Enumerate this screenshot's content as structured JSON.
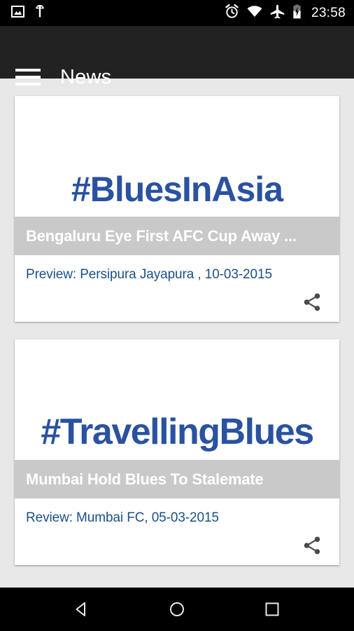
{
  "status_bar": {
    "time": "23:58",
    "left_icons": [
      {
        "name": "screenshot-icon",
        "label": "screenshot"
      },
      {
        "name": "android-debug-icon",
        "label": "android-debug"
      }
    ],
    "right_icons": [
      {
        "name": "alarm-icon",
        "label": "alarm"
      },
      {
        "name": "wifi-icon",
        "label": "wifi"
      },
      {
        "name": "airplane-mode-icon",
        "label": "airplane-mode"
      },
      {
        "name": "battery-charging-icon",
        "label": "battery-charging"
      }
    ],
    "background_color": "#000000"
  },
  "app_bar": {
    "title": "News",
    "menu_icon": "hamburger-icon",
    "background_color": "#222222",
    "title_color": "#ffffff"
  },
  "colors": {
    "page_background": "#e8e8e8",
    "card_background": "#ffffff",
    "hashtag_blue": "#2a52a0",
    "headline_overlay": "#c9c9c9",
    "headline_text": "#ffffff",
    "subtitle_blue": "#1b4f8a",
    "share_icon": "#4a4a4a"
  },
  "news_cards": [
    {
      "hashtag": "#BluesInAsia",
      "headline": "Bengaluru Eye First AFC Cup Away ...",
      "subtitle": "Preview: Persipura Jayapura , 10-03-2015",
      "share_label": "share-icon"
    },
    {
      "hashtag": "#TravellingBlues",
      "headline": "Mumbai Hold Blues To Stalemate",
      "subtitle": "Review: Mumbai FC, 05-03-2015",
      "share_label": "share-icon"
    }
  ],
  "nav_bar": {
    "background_color": "#000000",
    "buttons": [
      {
        "name": "back-button",
        "label": "Back"
      },
      {
        "name": "home-button",
        "label": "Home"
      },
      {
        "name": "recents-button",
        "label": "Recents"
      }
    ]
  }
}
